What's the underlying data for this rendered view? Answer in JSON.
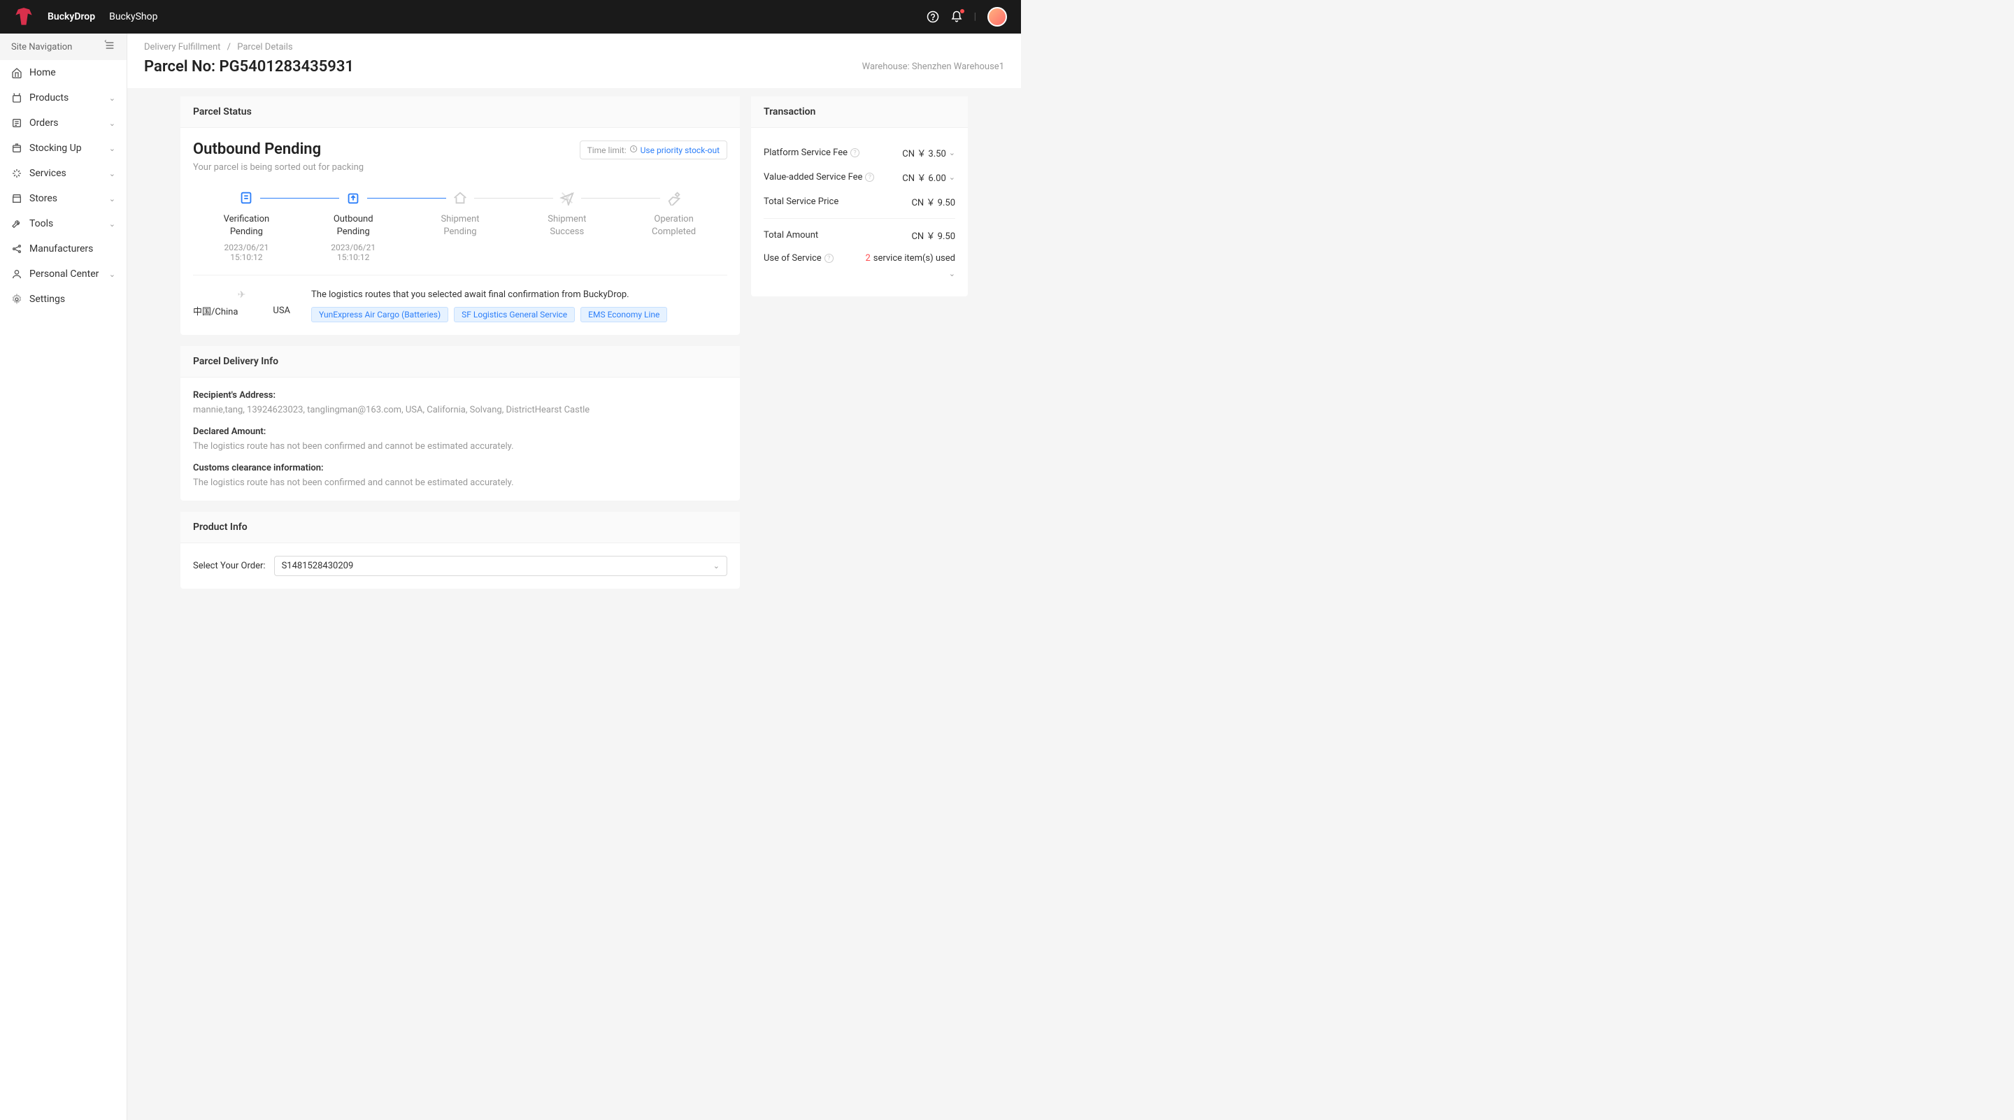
{
  "header": {
    "brand": "BuckyDrop",
    "sub": "BuckyShop"
  },
  "sidebar": {
    "title": "Site Navigation",
    "items": [
      {
        "label": "Home",
        "icon": "home",
        "expandable": false
      },
      {
        "label": "Products",
        "icon": "shopping-bag",
        "expandable": true
      },
      {
        "label": "Orders",
        "icon": "list",
        "expandable": true
      },
      {
        "label": "Stocking Up",
        "icon": "package",
        "expandable": true
      },
      {
        "label": "Services",
        "icon": "sparkle",
        "expandable": true
      },
      {
        "label": "Stores",
        "icon": "store",
        "expandable": true
      },
      {
        "label": "Tools",
        "icon": "wrench",
        "expandable": true
      },
      {
        "label": "Manufacturers",
        "icon": "share",
        "expandable": false
      },
      {
        "label": "Personal Center",
        "icon": "user",
        "expandable": true
      },
      {
        "label": "Settings",
        "icon": "gear",
        "expandable": false
      }
    ]
  },
  "breadcrumb": {
    "lvl1": "Delivery Fulfillment",
    "lvl2": "Parcel Details"
  },
  "parcel": {
    "no_label": "Parcel No: ",
    "no_value": "PG5401283435931",
    "warehouse": "Warehouse: Shenzhen Warehouse1"
  },
  "status": {
    "panel_title": "Parcel Status",
    "title": "Outbound Pending",
    "desc": "Your parcel is being sorted out for packing",
    "time_limit_label": "Time limit:",
    "priority_link": "Use priority stock-out",
    "steps": [
      {
        "title": "Verification Pending",
        "date": "2023/06/21",
        "time": "15:10:12",
        "active": true
      },
      {
        "title": "Outbound Pending",
        "date": "2023/06/21",
        "time": "15:10:12",
        "active": true
      },
      {
        "title": "Shipment Pending",
        "date": "",
        "time": "",
        "active": false
      },
      {
        "title": "Shipment Success",
        "date": "",
        "time": "",
        "active": false
      },
      {
        "title": "Operation Completed",
        "date": "",
        "time": "",
        "active": false
      }
    ],
    "route": {
      "from": "中国/China",
      "to": "USA",
      "msg": "The logistics routes that you selected await final confirmation from BuckyDrop.",
      "tags": [
        "YunExpress Air Cargo (Batteries)",
        "SF Logistics General Service",
        "EMS Economy Line"
      ]
    }
  },
  "delivery": {
    "panel_title": "Parcel Delivery Info",
    "recipient_label": "Recipient's Address:",
    "recipient_value": "mannie,tang, 13924623023, tanglingman@163.com, USA, California, Solvang, DistrictHearst Castle",
    "declared_label": "Declared Amount:",
    "declared_value": "The logistics route has not been confirmed and cannot be estimated accurately.",
    "customs_label": "Customs clearance information:",
    "customs_value": "The logistics route has not been confirmed and cannot be estimated accurately."
  },
  "product": {
    "panel_title": "Product Info",
    "select_label": "Select Your Order:",
    "select_value": "S1481528430209"
  },
  "transaction": {
    "panel_title": "Transaction",
    "platform_fee_label": "Platform Service Fee",
    "platform_fee_value": "CN ￥ 3.50",
    "value_added_label": "Value-added Service Fee",
    "value_added_value": "CN ￥ 6.00",
    "total_service_label": "Total Service Price",
    "total_service_value": "CN ￥ 9.50",
    "total_amount_label": "Total Amount",
    "total_amount_value": "CN ￥ 9.50",
    "use_service_label": "Use of Service",
    "use_service_count": "2",
    "use_service_suffix": " service item(s) used"
  }
}
